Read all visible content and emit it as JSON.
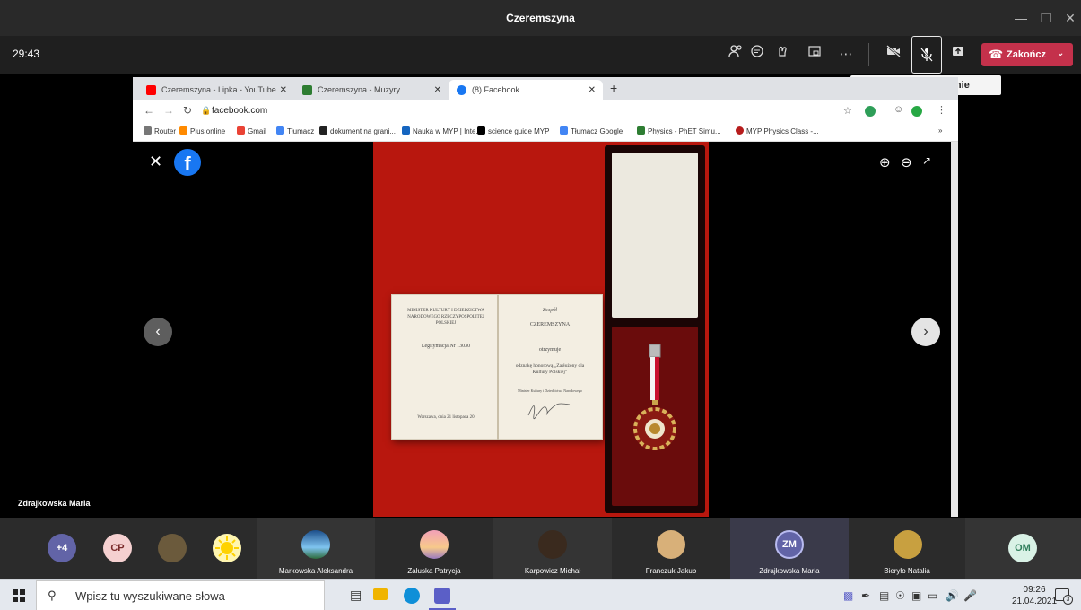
{
  "window": {
    "title": "Czeremszyna"
  },
  "meeting": {
    "timer": "29:43",
    "end_label": "Zakończ",
    "tooltip": "Wyłącz wyciszenie (Ctrl+Shift+M)"
  },
  "browser": {
    "tabs": [
      {
        "label": "Czeremszyna - Lipka - YouTube",
        "favicon_color": "#ff0000"
      },
      {
        "label": "Czeremszyna - Muzyry",
        "favicon_color": "#2e7d32"
      },
      {
        "label": "(8) Facebook",
        "favicon_color": "#1877f2"
      }
    ],
    "url": "facebook.com",
    "bookmarks": [
      {
        "label": "Router",
        "color": "#777777"
      },
      {
        "label": "Plus online",
        "color": "#ff8a00"
      },
      {
        "label": "Gmail",
        "color": "#ea4335"
      },
      {
        "label": "Tłumacz",
        "color": "#4285f4"
      },
      {
        "label": "dokument na grani...",
        "color": "#222222"
      },
      {
        "label": "Nauka w MYP | Inte...",
        "color": "#1565c0"
      },
      {
        "label": "science guide MYP",
        "color": "#000000"
      },
      {
        "label": "Tłumacz Google",
        "color": "#4285f4"
      },
      {
        "label": "Physics - PhET Simu...",
        "color": "#2e7d32"
      },
      {
        "label": "MYP Physics Class -...",
        "color": "#b71c1c"
      }
    ],
    "bookmarks_more": "»"
  },
  "certificate": {
    "left_header": "MINISTER KULTURY I DZIEDZICTWA NARODOWEGO RZECZYPOSPOLITEJ POLSKIEJ",
    "legitymacja": "Legitymacja Nr 13030",
    "date_line": "Warszawa, dnia 21 listopada 20",
    "right_header": "Zespół",
    "right_name": "CZEREMSZYNA",
    "otrzymuje": "otrzymuje",
    "award": "odznakę honorową „Zasłużony dla Kultury Polskiej”",
    "signer": "Minister Kultury i Dziedzictwa Narodowego"
  },
  "stage": {
    "label": "Zdrajkowska Maria"
  },
  "participants": {
    "overflow": "+4",
    "small": [
      {
        "initials": "CP",
        "bg": "#f5d0d0",
        "fg": "#7a2a2a"
      }
    ],
    "tiles": [
      {
        "name": "Markowska Aleksandra"
      },
      {
        "name": "Załuska Patrycja"
      },
      {
        "name": "Karpowicz Michał"
      },
      {
        "name": "Franczuk Jakub"
      },
      {
        "name": "Zdrajkowska Maria",
        "initials": "ZM"
      },
      {
        "name": "Bieryło Natalia"
      },
      {
        "name": "",
        "initials": "OM"
      }
    ]
  },
  "taskbar": {
    "search_placeholder": "Wpisz tu wyszukiwane słowa",
    "time": "09:26",
    "date": "21.04.2021",
    "notification_count": "3"
  }
}
